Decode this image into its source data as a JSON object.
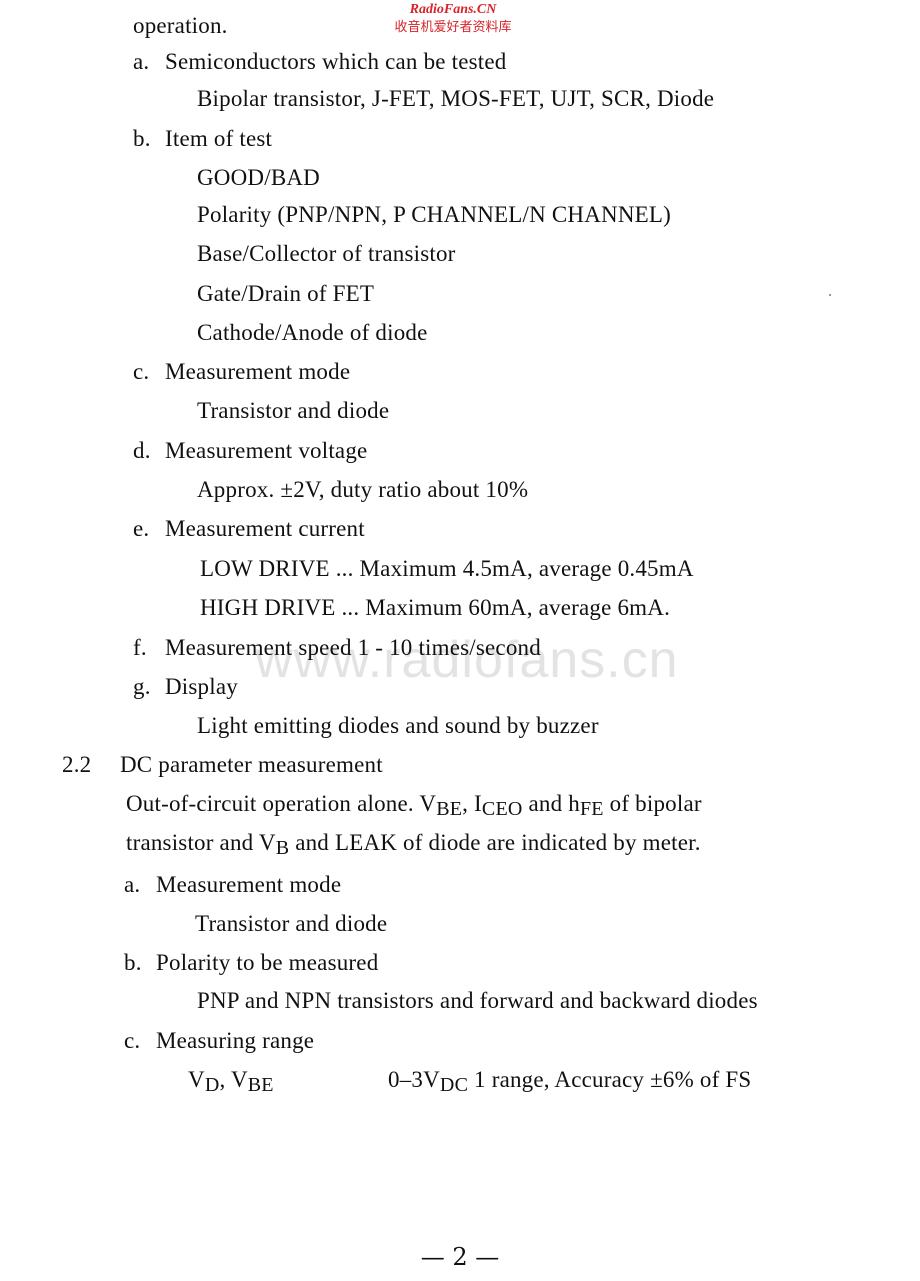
{
  "watermark": {
    "site": "RadioFans.CN",
    "site_cn": "收音机爱好者资料库",
    "center": "www.radiofans.cn"
  },
  "document": {
    "intro_tail": "operation.",
    "section_2_1_items": [
      {
        "marker": "a.",
        "title": "Semiconductors which can be tested",
        "details": [
          "Bipolar transistor, J-FET, MOS-FET, UJT, SCR, Diode"
        ]
      },
      {
        "marker": "b.",
        "title": "Item of test",
        "details": [
          "GOOD/BAD",
          "Polarity (PNP/NPN, P CHANNEL/N CHANNEL)",
          "Base/Collector of transistor",
          "Gate/Drain of FET",
          "Cathode/Anode of diode"
        ]
      },
      {
        "marker": "c.",
        "title": "Measurement mode",
        "details": [
          "Transistor and diode"
        ]
      },
      {
        "marker": "d.",
        "title": "Measurement voltage",
        "details": [
          "Approx. ±2V, duty ratio about 10%"
        ]
      },
      {
        "marker": "e.",
        "title": "Measurement current",
        "details": [
          "LOW DRIVE ... Maximum 4.5mA, average 0.45mA",
          "HIGH DRIVE ... Maximum 60mA, average 6mA."
        ]
      },
      {
        "marker": "f.",
        "title": "Measurement speed 1 - 10 times/second",
        "details": []
      },
      {
        "marker": "g.",
        "title": "Display",
        "details": [
          "Light emitting diodes and sound by buzzer"
        ]
      }
    ],
    "section_2_2": {
      "number": "2.2",
      "title": "DC parameter measurement",
      "para_line1": {
        "t1": "Out-of-circuit operation alone. V",
        "s1": "BE",
        "t2": ", I",
        "s2": "CEO",
        "t3": " and h",
        "s3": "FE",
        "t4": " of bipolar"
      },
      "para_line2": {
        "t1": "transistor and V",
        "s1": "B",
        "t2": " and LEAK of diode are indicated by meter."
      },
      "items": [
        {
          "marker": "a.",
          "title": "Measurement mode",
          "details": [
            "Transistor and diode"
          ]
        },
        {
          "marker": "b.",
          "title": "Polarity to be measured",
          "details": [
            "PNP and NPN transistors and forward and backward diodes"
          ]
        },
        {
          "marker": "c.",
          "title": "Measuring range"
        }
      ],
      "range_row": {
        "label_v1": "V",
        "label_s1": "D",
        "label_sep": ", V",
        "label_s2": "BE",
        "value_t1": "0–3V",
        "value_s1": "DC",
        "value_t2": " 1 range, Accuracy ±6% of FS"
      }
    },
    "page_number": "— 2 —"
  }
}
